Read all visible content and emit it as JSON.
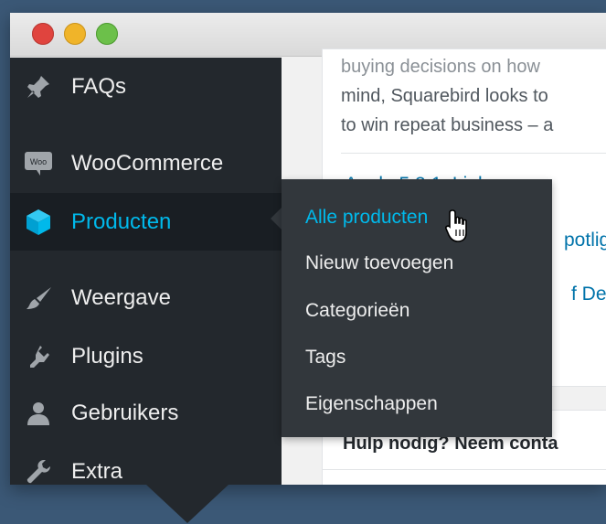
{
  "window": {
    "controls": [
      "close",
      "minimize",
      "maximize"
    ]
  },
  "sidebar": {
    "items": [
      {
        "label": "FAQs",
        "icon": "pin-icon"
      },
      {
        "label": "WooCommerce",
        "icon": "woocommerce-icon",
        "icon_text": "Woo"
      },
      {
        "label": "Producten",
        "icon": "cube-icon",
        "active": true
      },
      {
        "label": "Weergave",
        "icon": "brush-icon"
      },
      {
        "label": "Plugins",
        "icon": "plugin-icon"
      },
      {
        "label": "Gebruikers",
        "icon": "user-icon"
      },
      {
        "label": "Extra",
        "icon": "wrench-icon"
      }
    ]
  },
  "flyout": {
    "items": [
      {
        "label": "Alle producten",
        "current": true
      },
      {
        "label": "Nieuw toevoegen"
      },
      {
        "label": "Categorieën"
      },
      {
        "label": "Tags"
      },
      {
        "label": "Eigenschappen"
      }
    ]
  },
  "content": {
    "paragraph_lines": [
      "buying decisions on how",
      "mind, Squarebird looks to",
      "to win repeat business – a"
    ],
    "news_links": [
      "Apple 5.3.1: Link",
      "potligh",
      "f Dea"
    ],
    "help_title": "Hulp nodig? Neem conta"
  },
  "colors": {
    "background": "#3b5876",
    "sidebar": "#23282d",
    "flyout": "#32373c",
    "accent": "#00b9eb",
    "link": "#0073aa"
  }
}
